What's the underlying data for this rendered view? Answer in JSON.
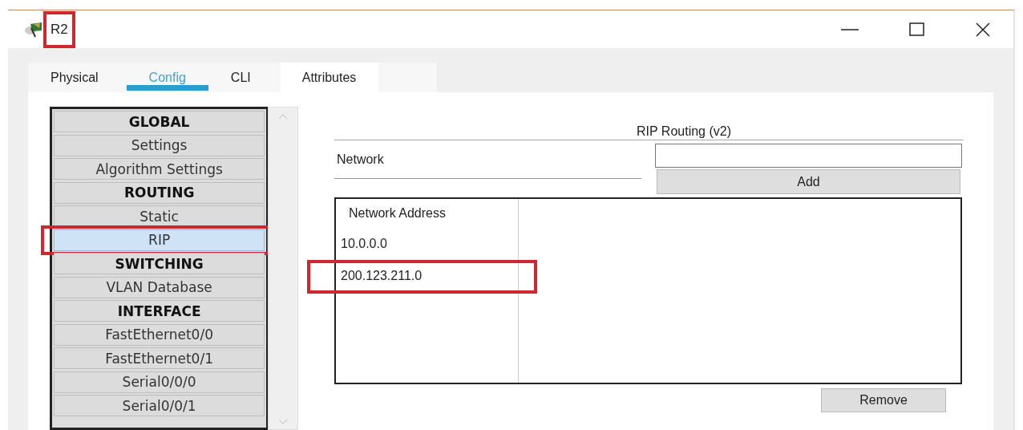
{
  "window": {
    "title": "R2",
    "title_highlighted": true
  },
  "tabs": [
    {
      "label": "Physical",
      "selected": false
    },
    {
      "label": "Config",
      "selected": true
    },
    {
      "label": "CLI",
      "selected": false
    },
    {
      "label": "Attributes",
      "selected": false
    }
  ],
  "sidebar": {
    "items": [
      {
        "label": "GLOBAL",
        "kind": "header",
        "selected": false,
        "highlighted": false
      },
      {
        "label": "Settings",
        "kind": "item",
        "selected": false,
        "highlighted": false
      },
      {
        "label": "Algorithm Settings",
        "kind": "item",
        "selected": false,
        "highlighted": false
      },
      {
        "label": "ROUTING",
        "kind": "header",
        "selected": false,
        "highlighted": false
      },
      {
        "label": "Static",
        "kind": "item",
        "selected": false,
        "highlighted": false
      },
      {
        "label": "RIP",
        "kind": "item",
        "selected": true,
        "highlighted": true
      },
      {
        "label": "SWITCHING",
        "kind": "header",
        "selected": false,
        "highlighted": false
      },
      {
        "label": "VLAN Database",
        "kind": "item",
        "selected": false,
        "highlighted": false
      },
      {
        "label": "INTERFACE",
        "kind": "header",
        "selected": false,
        "highlighted": false
      },
      {
        "label": "FastEthernet0/0",
        "kind": "item",
        "selected": false,
        "highlighted": false
      },
      {
        "label": "FastEthernet0/1",
        "kind": "item",
        "selected": false,
        "highlighted": false
      },
      {
        "label": "Serial0/0/0",
        "kind": "item",
        "selected": false,
        "highlighted": false
      },
      {
        "label": "Serial0/0/1",
        "kind": "item",
        "selected": false,
        "highlighted": false
      }
    ]
  },
  "rip": {
    "title": "RIP Routing (v2)",
    "network_label": "Network",
    "add_button": "Add",
    "table": {
      "columns": [
        "Network Address"
      ],
      "rows": [
        {
          "cells": [
            "10.0.0.0"
          ],
          "highlighted": false
        },
        {
          "cells": [
            "200.123.211.0"
          ],
          "highlighted": true
        }
      ]
    },
    "remove_button": "Remove"
  }
}
